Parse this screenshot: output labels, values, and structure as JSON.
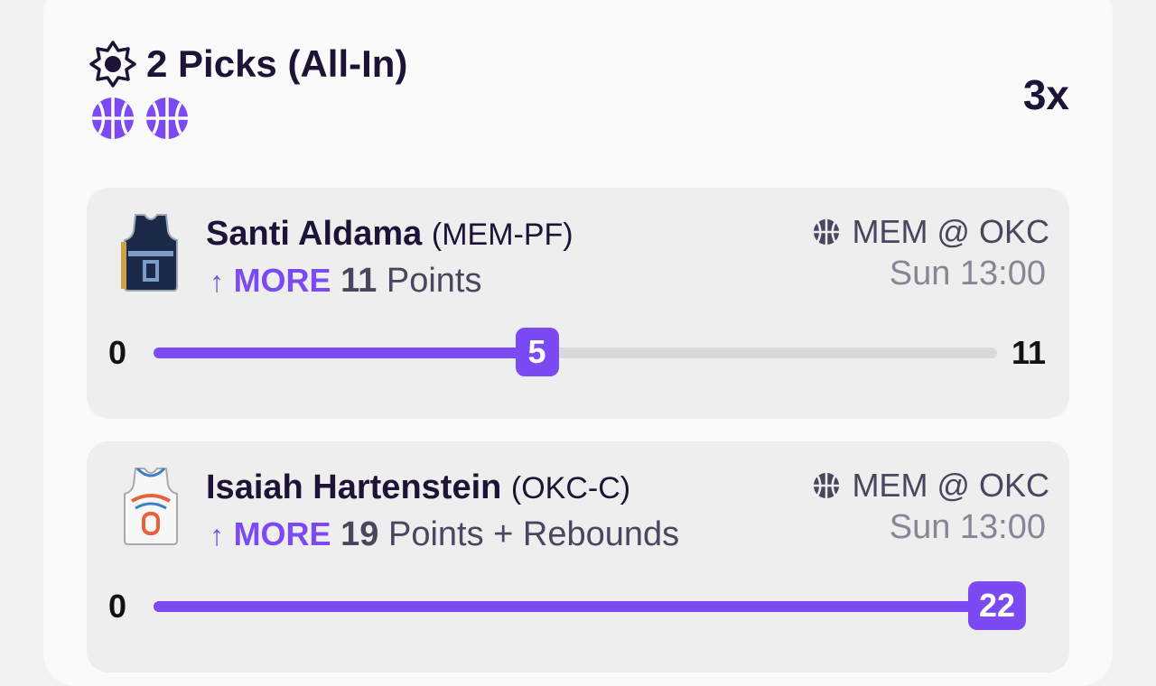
{
  "header": {
    "title": "2 Picks (All-In)",
    "title_icon": "sun-badge-icon",
    "multiplier": "3x",
    "sport_icons": [
      "basketball-icon",
      "basketball-icon"
    ]
  },
  "colors": {
    "accent": "#7b4af2",
    "text": "#1d1336",
    "muted": "#8a8596"
  },
  "picks": [
    {
      "player": "Santi Aldama",
      "position": "(MEM-PF)",
      "direction": "MORE",
      "line_value": "11",
      "stat": "Points",
      "matchup": "MEM @ OKC",
      "time": "Sun 13:00",
      "min": "0",
      "max": "11",
      "current": "5",
      "progress_fraction": 0.4545,
      "jersey": "memphis-jersey-icon"
    },
    {
      "player": "Isaiah Hartenstein",
      "position": "(OKC-C)",
      "direction": "MORE",
      "line_value": "19",
      "stat": "Points + Rebounds",
      "matchup": "MEM @ OKC",
      "time": "Sun 13:00",
      "min": "0",
      "max": "",
      "current": "22",
      "progress_fraction": 1.0,
      "jersey": "okc-jersey-icon"
    }
  ]
}
